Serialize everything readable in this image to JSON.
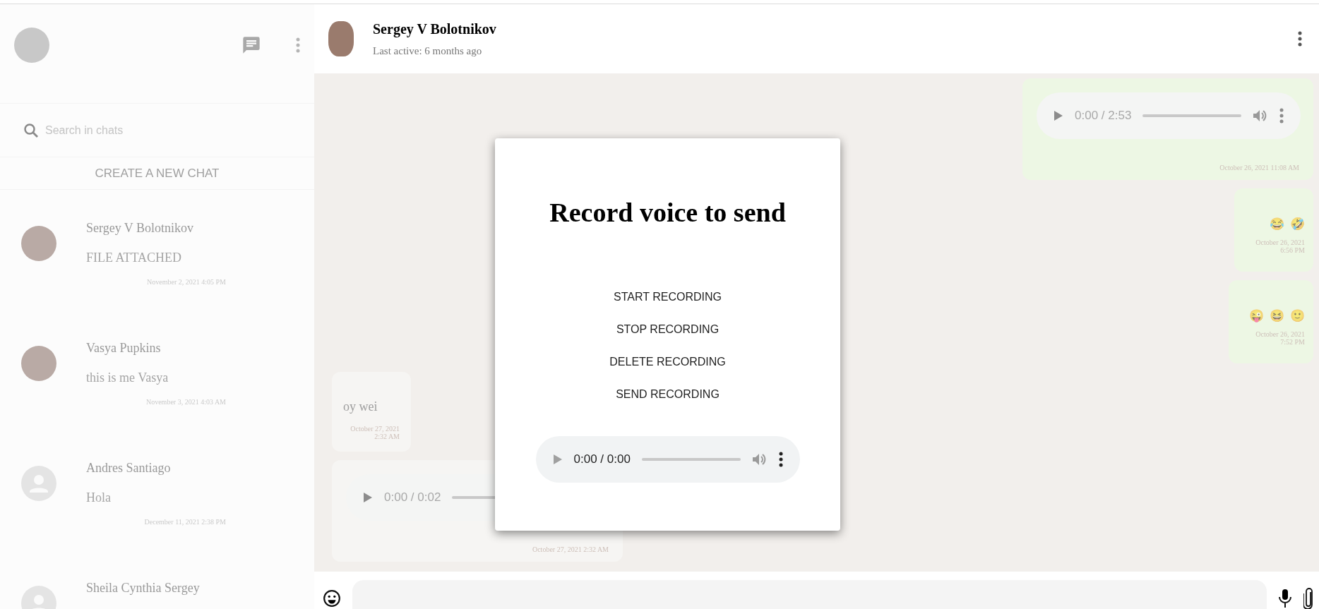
{
  "sidebar": {
    "search": {
      "placeholder": "Search in chats"
    },
    "create_button": "CREATE A NEW CHAT",
    "chats": [
      {
        "name": "Sergey V Bolotnikov",
        "preview": "FILE ATTACHED",
        "time": "November 2, 2021 4:05 PM",
        "kind": "photo"
      },
      {
        "name": "Vasya Pupkins",
        "preview": "this is me Vasya",
        "time": "November 3, 2021 4:03 AM",
        "kind": "photo"
      },
      {
        "name": "Andres Santiago",
        "preview": "Hola",
        "time": "December 11, 2021 2:38 PM",
        "kind": "default"
      },
      {
        "name": "Sheila Cynthia Sergey",
        "kind": "default"
      }
    ]
  },
  "chat_header": {
    "name": "Sergey V Bolotnikov",
    "status": "Last active: 6 months ago"
  },
  "messages": [
    {
      "kind": "audio",
      "outgoing": true,
      "time_display": "0:00 / 2:53",
      "timestamp": "October 26, 2021 11:08 AM"
    },
    {
      "kind": "emoji",
      "outgoing": true,
      "emojis": [
        "😂",
        "🤣"
      ],
      "timestamp": "October 26, 2021 6:56 PM"
    },
    {
      "kind": "emoji",
      "outgoing": true,
      "emojis": [
        "😜",
        "😆",
        "🙂"
      ],
      "timestamp": "October 26, 2021 7:52 PM"
    },
    {
      "kind": "text",
      "outgoing": false,
      "text": "oy wei",
      "timestamp": "October 27, 2021 2:32 AM"
    },
    {
      "kind": "audio",
      "outgoing": false,
      "time_display": "0:00 / 0:02",
      "timestamp": "October 27, 2021 2:32 AM"
    }
  ],
  "modal": {
    "title": "Record voice to send",
    "buttons": [
      "START RECORDING",
      "STOP RECORDING",
      "DELETE RECORDING",
      "SEND RECORDING"
    ],
    "player": {
      "time_display": "0:00 / 0:00"
    }
  }
}
